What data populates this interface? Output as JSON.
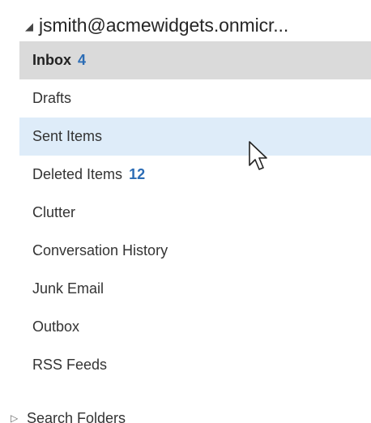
{
  "account": {
    "name": "jsmith@acmewidgets.onmicr...",
    "expander_icon": "expanded-triangle-icon"
  },
  "folders": [
    {
      "label": "Inbox",
      "count": "4",
      "state": "selected"
    },
    {
      "label": "Drafts",
      "count": ""
    },
    {
      "label": "Sent Items",
      "count": "",
      "state": "hovered"
    },
    {
      "label": "Deleted Items",
      "count": "12"
    },
    {
      "label": "Clutter",
      "count": ""
    },
    {
      "label": "Conversation History",
      "count": ""
    },
    {
      "label": "Junk Email",
      "count": ""
    },
    {
      "label": "Outbox",
      "count": ""
    },
    {
      "label": "RSS Feeds",
      "count": ""
    }
  ],
  "search_folders": {
    "label": "Search Folders",
    "expander_icon": "collapsed-triangle-icon"
  },
  "colors": {
    "selected_background": "#dadada",
    "hover_background": "#deecf9",
    "unread_count": "#2b6cb5"
  },
  "cursor_icon": "mouse-pointer-icon"
}
